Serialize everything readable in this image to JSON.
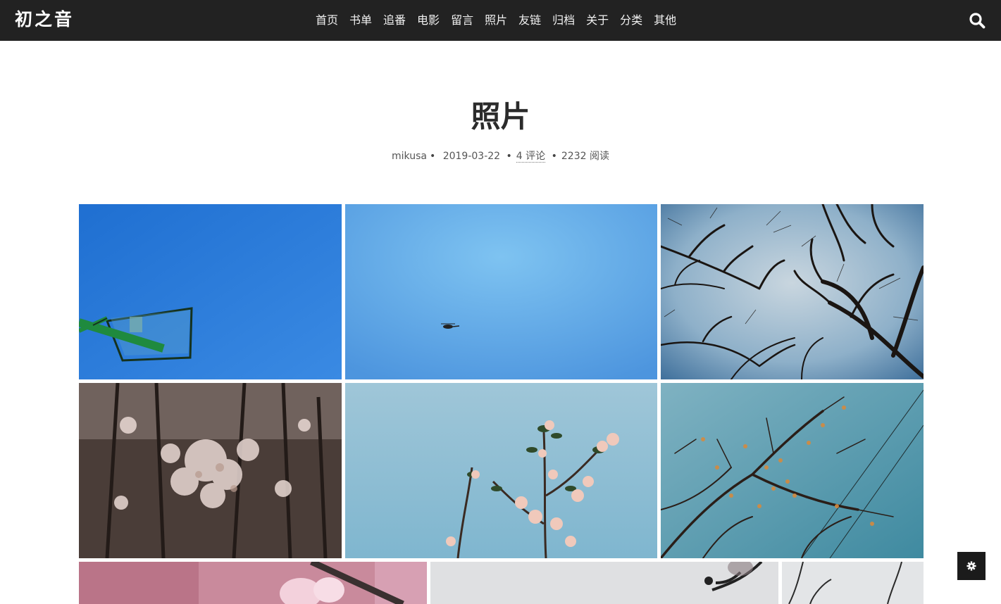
{
  "brand": {
    "name": "初之音"
  },
  "nav": {
    "items": [
      {
        "label": "首页"
      },
      {
        "label": "书单"
      },
      {
        "label": "追番"
      },
      {
        "label": "电影"
      },
      {
        "label": "留言"
      },
      {
        "label": "照片"
      },
      {
        "label": "友链"
      },
      {
        "label": "归档"
      },
      {
        "label": "关于"
      },
      {
        "label": "分类"
      },
      {
        "label": "其他"
      }
    ],
    "search_icon": "search-icon"
  },
  "post": {
    "title": "照片",
    "author": "mikusa",
    "date": "2019-03-22",
    "comments": "4 评论",
    "views": "2232 阅读",
    "separator": "•"
  },
  "gallery": {
    "photos": [
      {
        "subject": "basketball hoop against blue sky"
      },
      {
        "subject": "helicopter in blue sky"
      },
      {
        "subject": "bare tree branches looking up"
      },
      {
        "subject": "cherry blossoms in forest"
      },
      {
        "subject": "apple blossoms against sky"
      },
      {
        "subject": "branches with orange buds"
      },
      {
        "subject": "pink flower close-up"
      },
      {
        "subject": "blossom branch silhouette"
      },
      {
        "subject": "bare branches grey sky"
      }
    ]
  },
  "floating": {
    "settings_icon": "gear-icon"
  },
  "colors": {
    "nav_bg": "#222222",
    "title": "#2b2b2b",
    "meta": "#555555"
  }
}
